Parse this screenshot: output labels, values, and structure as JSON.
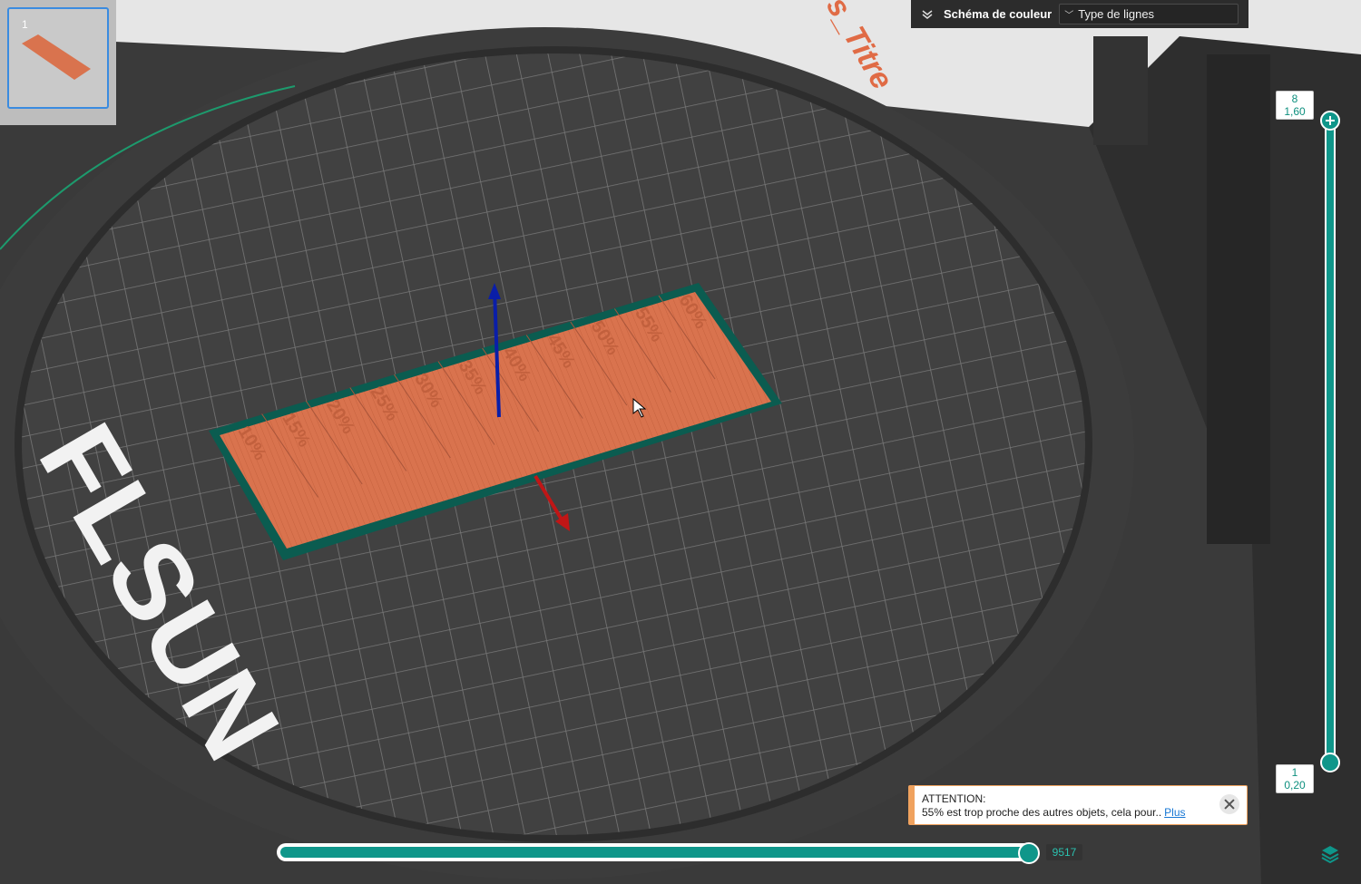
{
  "thumbnail": {
    "plate_number": "1"
  },
  "scheme": {
    "label": "Schéma de couleur",
    "selected": "Type de lignes"
  },
  "layer_slider": {
    "top_layer": "8",
    "top_height": "1,60",
    "bottom_layer": "1",
    "bottom_height": "0,20"
  },
  "move_slider": {
    "value": "9517",
    "progress": 1.0
  },
  "warning": {
    "title": "ATTENTION:",
    "message": "55% est trop proche des autres objets, cela pour..",
    "link": "Plus"
  },
  "scene": {
    "object_labels": [
      "10%",
      "15%",
      "20%",
      "25%",
      "30%",
      "35%",
      "40%",
      "45%",
      "50%",
      "55%",
      "60%"
    ],
    "bed_logo": "FLSUN",
    "background_text": "s_Titre"
  },
  "colors": {
    "accent": "#0f968a",
    "model": "#d9734e",
    "bed": "#3e3e3e",
    "warning": "#f0a25e"
  }
}
